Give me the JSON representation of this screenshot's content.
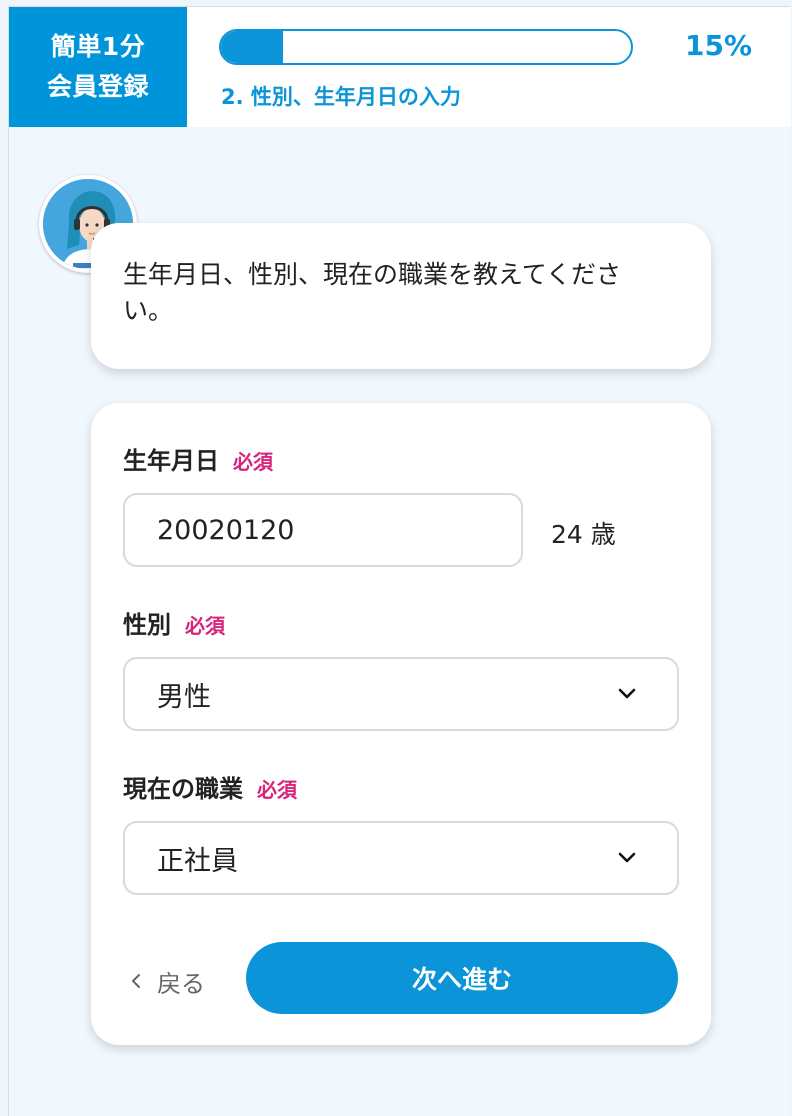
{
  "header": {
    "badge_line1": "簡単1分",
    "badge_line2": "会員登録",
    "progress_percent": 15,
    "progress_label": "15%",
    "step_label": "2. 性別、生年月日の入力"
  },
  "bubble": {
    "line1": "生年月日、性別、現在の職業を教えてくださ",
    "line2": "い。"
  },
  "form": {
    "birthdate": {
      "label": "生年月日",
      "required": "必須",
      "value": "20020120",
      "age": "24 歳"
    },
    "gender": {
      "label": "性別",
      "required": "必須",
      "selected": "男性"
    },
    "occupation": {
      "label": "現在の職業",
      "required": "必須",
      "selected": "正社員"
    },
    "back_label": "戻る",
    "next_label": "次へ進む"
  },
  "colors": {
    "accent": "#0b95d8",
    "badge": "#0095db",
    "required": "#d8237a",
    "page_bg": "#f0f7fd"
  },
  "icons": {
    "avatar": "operator-avatar",
    "select_indicator": "chevron-down-icon",
    "back_indicator": "chevron-left-icon"
  }
}
